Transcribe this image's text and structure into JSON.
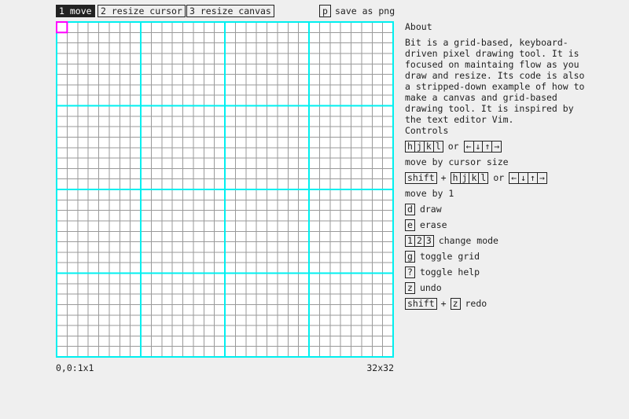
{
  "toolbar": {
    "modes": [
      "1 move",
      "2 resize cursor",
      "3 resize canvas"
    ],
    "save_key": "p",
    "save_label": "save as png"
  },
  "canvas": {
    "grid_cells": 32,
    "major_every": 8,
    "colors": {
      "background": "#ffffff",
      "minor_grid": "#9a9a9a",
      "major_grid": "#00f0f0",
      "cursor": "#ff00ff"
    }
  },
  "status": {
    "cursor": "0,0:1x1",
    "size": "32x32"
  },
  "about": {
    "title": "About",
    "text": "Bit is a grid-based, keyboard-driven pixel drawing tool. It is focused on maintaing flow as you draw and resize. Its code is also a stripped-down example of how to make a canvas and grid-based drawing tool. It is inspired by the text editor Vim."
  },
  "controls": {
    "title": "Controls",
    "hjkl": [
      "h",
      "j",
      "k",
      "l"
    ],
    "arrows": [
      "←",
      "↓",
      "↑",
      "→"
    ],
    "or": "or",
    "plus": "+",
    "shift": "shift",
    "move_cursor_size": "move by cursor size",
    "move_by_one": "move by 1",
    "draw_key": "d",
    "draw": "draw",
    "erase_key": "e",
    "erase": "erase",
    "mode_keys": [
      "1",
      "2",
      "3"
    ],
    "change_mode": "change mode",
    "grid_key": "g",
    "toggle_grid": "toggle grid",
    "help_key": "?",
    "toggle_help": "toggle help",
    "undo_key": "z",
    "undo": "undo",
    "redo_key": "z",
    "redo": "redo"
  }
}
